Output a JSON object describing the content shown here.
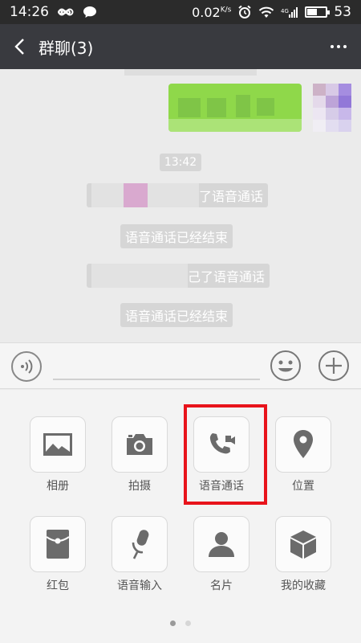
{
  "status_bar": {
    "time": "14:26",
    "speed": "0.02",
    "speed_unit": "K/s",
    "battery": "53"
  },
  "header": {
    "title": "群聊(3)"
  },
  "chat": {
    "timestamp": "13:42",
    "messages": [
      {
        "type": "system",
        "text": "了语音通话"
      },
      {
        "type": "system",
        "text": "语音通话已经结束"
      },
      {
        "type": "system",
        "text": "己了语音通话"
      },
      {
        "type": "system",
        "text": "语音通话已经结束"
      }
    ]
  },
  "panel": {
    "items": [
      {
        "label": "相册",
        "icon": "photo-album-icon"
      },
      {
        "label": "拍摄",
        "icon": "camera-icon"
      },
      {
        "label": "语音通话",
        "icon": "phone-video-icon"
      },
      {
        "label": "位置",
        "icon": "location-pin-icon"
      },
      {
        "label": "红包",
        "icon": "red-envelope-icon"
      },
      {
        "label": "语音输入",
        "icon": "microphone-icon"
      },
      {
        "label": "名片",
        "icon": "contact-card-icon"
      },
      {
        "label": "我的收藏",
        "icon": "favorites-box-icon"
      }
    ],
    "active_page": 1,
    "page_count": 2
  },
  "colors": {
    "highlight": "#e8131b",
    "header_bg": "#393a3f",
    "statusbar_bg": "#2b2b2b",
    "chat_bg": "#ebebeb",
    "my_bubble": "#8fd84a",
    "icon_gray": "#6b6b6b"
  }
}
